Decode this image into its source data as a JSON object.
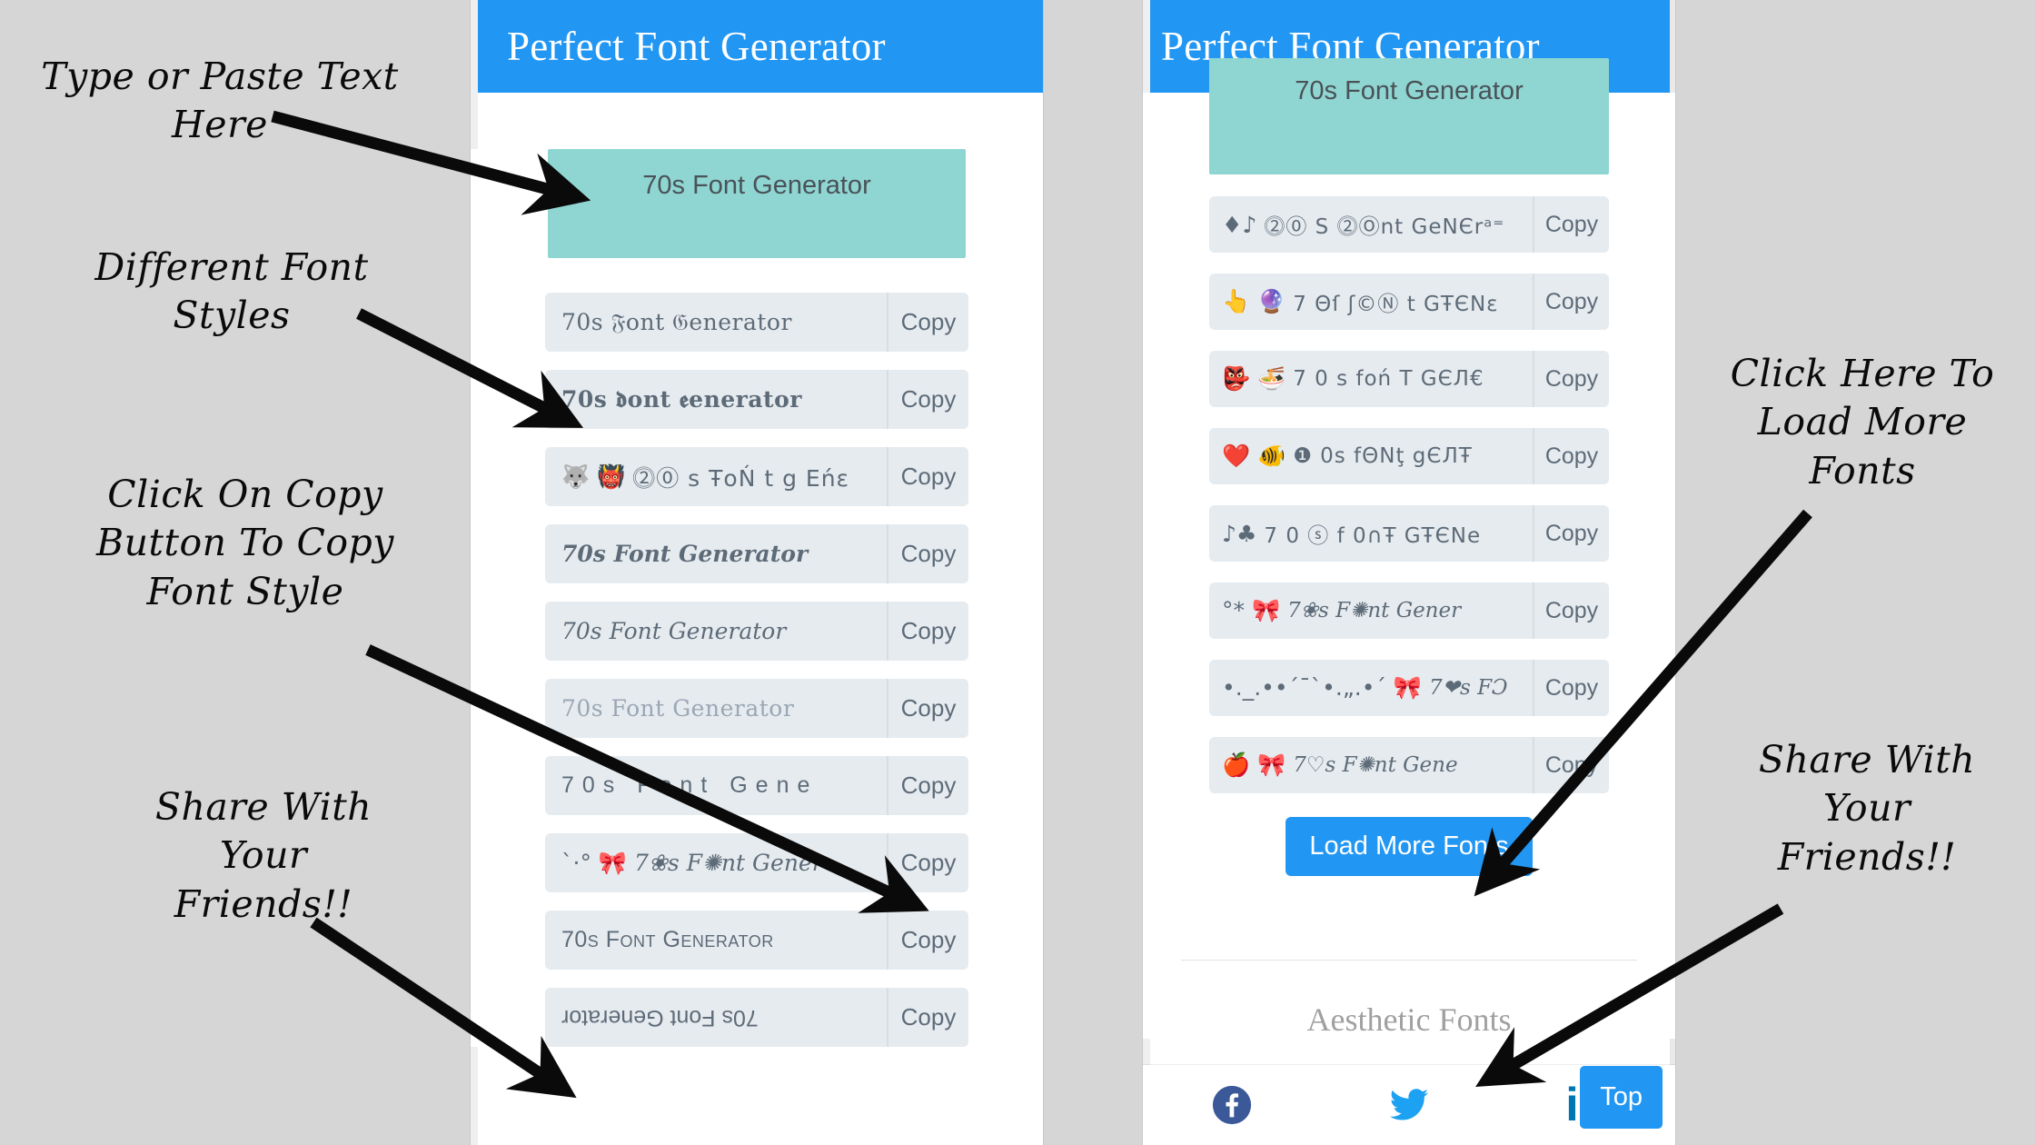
{
  "app": {
    "title": "Perfect Font Generator",
    "brand_color": "#2196f3",
    "textarea_color": "#8fd6d3"
  },
  "left_panel": {
    "header_title": "Perfect Font Generator",
    "textarea_value": "70s Font Generator",
    "textarea_placeholder": "Type or paste text here",
    "copy_label": "Copy",
    "rows": [
      {
        "style": "fs-fraktur",
        "emoji": "",
        "text": "70s 𝔉ont 𝔊enerator"
      },
      {
        "style": "fs-fraktur-bold",
        "emoji": "",
        "text": "70s 𝖉ont 𝖊enerator"
      },
      {
        "style": "fs-circled",
        "emoji": "🐺 👹",
        "text": "⓶⓪ s ŦoŃ t  g Eńε"
      },
      {
        "style": "fs-bolditalic",
        "emoji": "",
        "text": "70s Font Generator"
      },
      {
        "style": "fs-italic",
        "emoji": "",
        "text": "70s Font Generator"
      },
      {
        "style": "fs-outline",
        "emoji": "",
        "text": "70s Font Generator"
      },
      {
        "style": "fs-wide",
        "emoji": "",
        "text": "70s Font Gene"
      },
      {
        "style": "fs-scriptfancy",
        "emoji": "`·° 🎀",
        "text": "7❀s F✺nt Gener"
      },
      {
        "style": "fs-smallcaps",
        "emoji": "",
        "text": "70s Font Generator"
      },
      {
        "style": "fs-upsidedown",
        "emoji": "",
        "text": "70s Font Generator"
      }
    ]
  },
  "right_panel": {
    "header_title": "Perfect Font Generator",
    "textarea_value": "70s Font Generator",
    "copy_label": "Copy",
    "load_more_label": "Load More Fonts",
    "top_label": "Top",
    "footer_heading": "Aesthetic Fonts",
    "rows": [
      {
        "style": "fs-circled",
        "emoji": "♦♪",
        "text": "⓶⓪ S ⓶Ⓞnt GeNЄrᵃ⁼"
      },
      {
        "style": "fs-circled",
        "emoji": "👆 🔮",
        "text": "7 Θſ ʃ©Ⓝ t  GŦЄNε"
      },
      {
        "style": "fs-circled",
        "emoji": "👺 🍜",
        "text": "7 0 s foń T  GЄЛ€"
      },
      {
        "style": "fs-circled",
        "emoji": "❤️ 🐠",
        "text": "❶ 0s fΘNţ gЄЛŦ"
      },
      {
        "style": "fs-circled",
        "emoji": "♪♣",
        "text": "7 0 ⓢ  f 0∩Ŧ GŦЄNe"
      },
      {
        "style": "fs-scriptfancy",
        "emoji": "°* 🎀",
        "text": "7❀s F✺nt Gener"
      },
      {
        "style": "fs-scriptfancy",
        "emoji": "•._.••´¯`•.„.•´ 🎀",
        "text": "7❤s FƆ"
      },
      {
        "style": "fs-scriptfancy",
        "emoji": "🍎 🎀",
        "text": "7♡s F✺nt Gene"
      }
    ],
    "social": [
      {
        "name": "facebook",
        "label": "f"
      },
      {
        "name": "twitter",
        "label": ""
      },
      {
        "name": "linkedin",
        "label": "in"
      }
    ]
  },
  "annotations": {
    "type_or_paste": "Type or Paste Text\nHere",
    "different_font": "Different Font\nStyles",
    "click_copy": "Click On Copy\nButton To Copy\nFont Style",
    "share_left": "Share With\nYour\nFriends!!",
    "click_load_more": "Click Here To\nLoad More\nFonts",
    "share_right": "Share With\nYour\nFriends!!"
  }
}
